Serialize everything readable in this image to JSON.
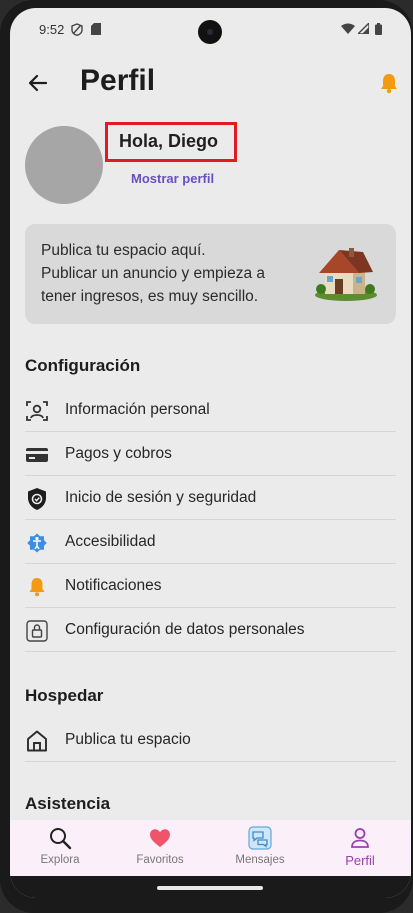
{
  "status_bar": {
    "time": "9:52"
  },
  "header": {
    "title": "Perfil"
  },
  "profile": {
    "greeting": "Hola, Diego",
    "show_profile_link": "Mostrar perfil"
  },
  "promo": {
    "line1": "Publica tu espacio aquí.",
    "line2": "Publicar un anuncio y empieza a",
    "line3": "tener ingresos, es muy sencillo."
  },
  "settings": {
    "title": "Configuración",
    "items": [
      {
        "label": "Información personal",
        "icon": "user-id-icon"
      },
      {
        "label": "Pagos y cobros",
        "icon": "credit-card-icon"
      },
      {
        "label": "Inicio de sesión y seguridad",
        "icon": "shield-icon"
      },
      {
        "label": "Accesibilidad",
        "icon": "accessibility-icon"
      },
      {
        "label": "Notificaciones",
        "icon": "bell-icon"
      },
      {
        "label": "Configuración de datos personales",
        "icon": "lock-icon"
      }
    ]
  },
  "hosting": {
    "title": "Hospedar",
    "items": [
      {
        "label": "Publica tu espacio",
        "icon": "house-icon"
      }
    ]
  },
  "support": {
    "title": "Asistencia"
  },
  "bottom_nav": {
    "items": [
      {
        "label": "Explora",
        "icon": "search-icon"
      },
      {
        "label": "Favoritos",
        "icon": "heart-icon"
      },
      {
        "label": "Mensajes",
        "icon": "chat-icon"
      },
      {
        "label": "Perfil",
        "icon": "person-icon",
        "active": true
      }
    ]
  },
  "colors": {
    "accent": "#6a4fc0",
    "highlight_box": "#e21a23",
    "bell": "#f39a12",
    "heart": "#f0546b",
    "active_nav": "#9a3fb0"
  }
}
